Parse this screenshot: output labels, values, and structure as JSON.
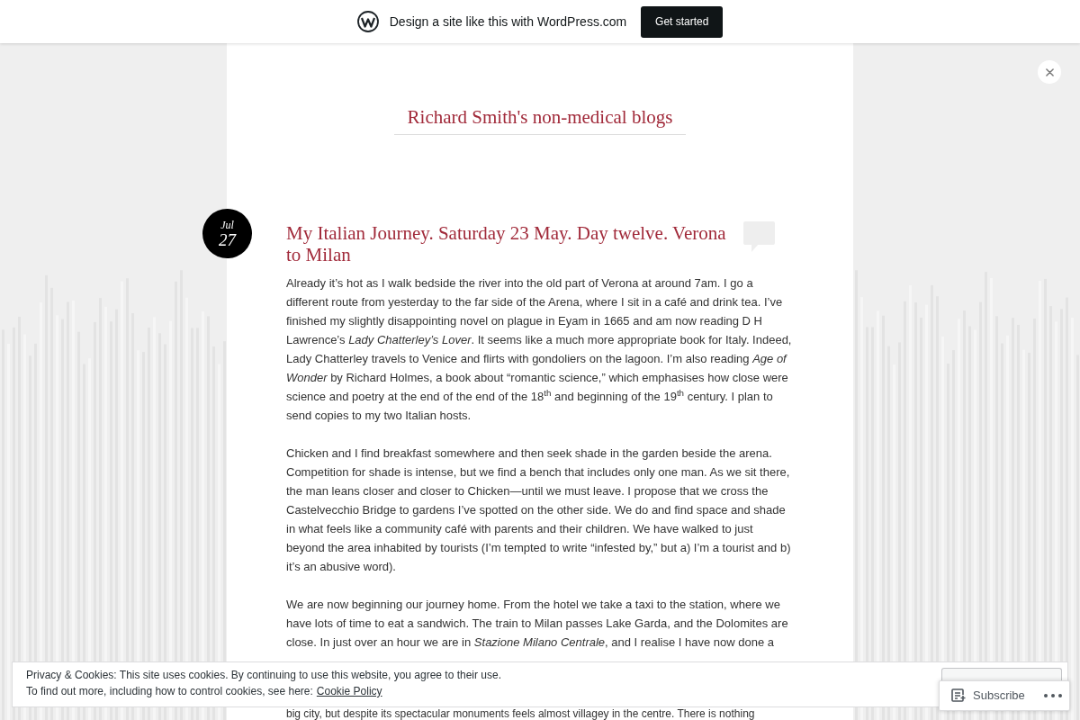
{
  "promo_bar": {
    "text": "Design a site like this with WordPress.com",
    "button": "Get started"
  },
  "site_title": "Richard Smith's non-medical blogs",
  "post": {
    "date": {
      "month": "Jul",
      "day": "27"
    },
    "title": "My Italian Journey. Saturday 23 May. Day twelve. Verona to Milan",
    "paragraphs": [
      "Already it’s hot as I walk bedside the river into the old part of Verona at around 7am. I go a different route from yesterday to the far side of the Arena, where I sit in a café and drink tea. I’ve finished my slightly disappointing novel on plague in Eyam in 1665 and am now reading D H Lawrence’s *Lady Chatterley’s Lover*. It seems like a much more appropriate book for Italy. Indeed, Lady Chatterley travels to Venice and flirts with gondoliers on the lagoon. I’m also reading *Age of Wonder* by Richard Holmes, a book about “romantic science,” which emphasises how close were science and poetry at the end of the end of the 18$^{th}$ and beginning of the 19$^{th}$ century. I plan to send copies to my two Italian hosts.",
      "Chicken and I find breakfast somewhere and then seek shade in the garden beside the arena. Competition for shade is intense, but we find a bench that includes only one man. As we sit there, the man leans closer and closer to Chicken—until we must leave. I propose that we cross the Castelvecchio Bridge to gardens I’ve spotted on the other side. We do and find space and shade in what feels like a community café with parents and their children. We have walked to just beyond the area inhabited by tourists (I’m tempted to write “infested by,” but a) I’m a tourist and b) it’s an abusive word).",
      "We are now beginning our journey home. From the hotel we take a taxi to the station, where we have lots of time to eat a sandwich. The train to Milan passes Lake Garda, and the Dolomites are close. In just over an hour we are in *Stazione Milano Centrale*, and I realise I have now done a"
    ],
    "cut_off_line": "big city, but despite its spectacular monuments feels almost villagey in the centre. There is nothing"
  },
  "cookie_banner": {
    "line_1": "Privacy & Cookies: This site uses cookies. By continuing to use this website, you agree to their use.",
    "line_2": "To find out more, including how to control cookies, see here:",
    "link": "Cookie Policy"
  },
  "subscribe_bar": {
    "label": "Subscribe"
  }
}
